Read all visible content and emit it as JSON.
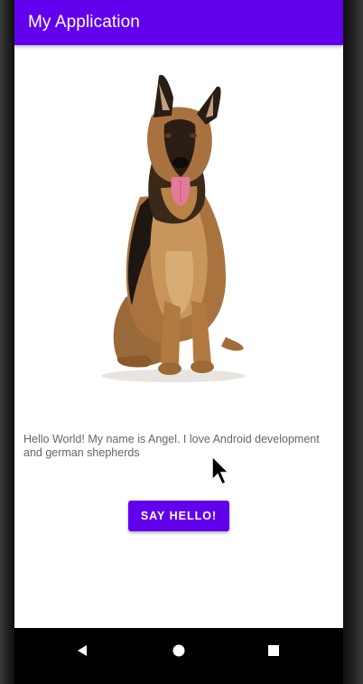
{
  "app_bar": {
    "title": "My Application",
    "color": "#6200ee"
  },
  "main": {
    "image": {
      "subject": "german-shepherd-photo"
    },
    "hello_text": "Hello World! My name is Angel. I love Android development and german shepherds",
    "say_hello_label": "SAY HELLO!"
  },
  "nav_bar": {
    "back_icon": "back-triangle-icon",
    "home_icon": "home-circle-icon",
    "recents_icon": "recents-square-icon"
  }
}
